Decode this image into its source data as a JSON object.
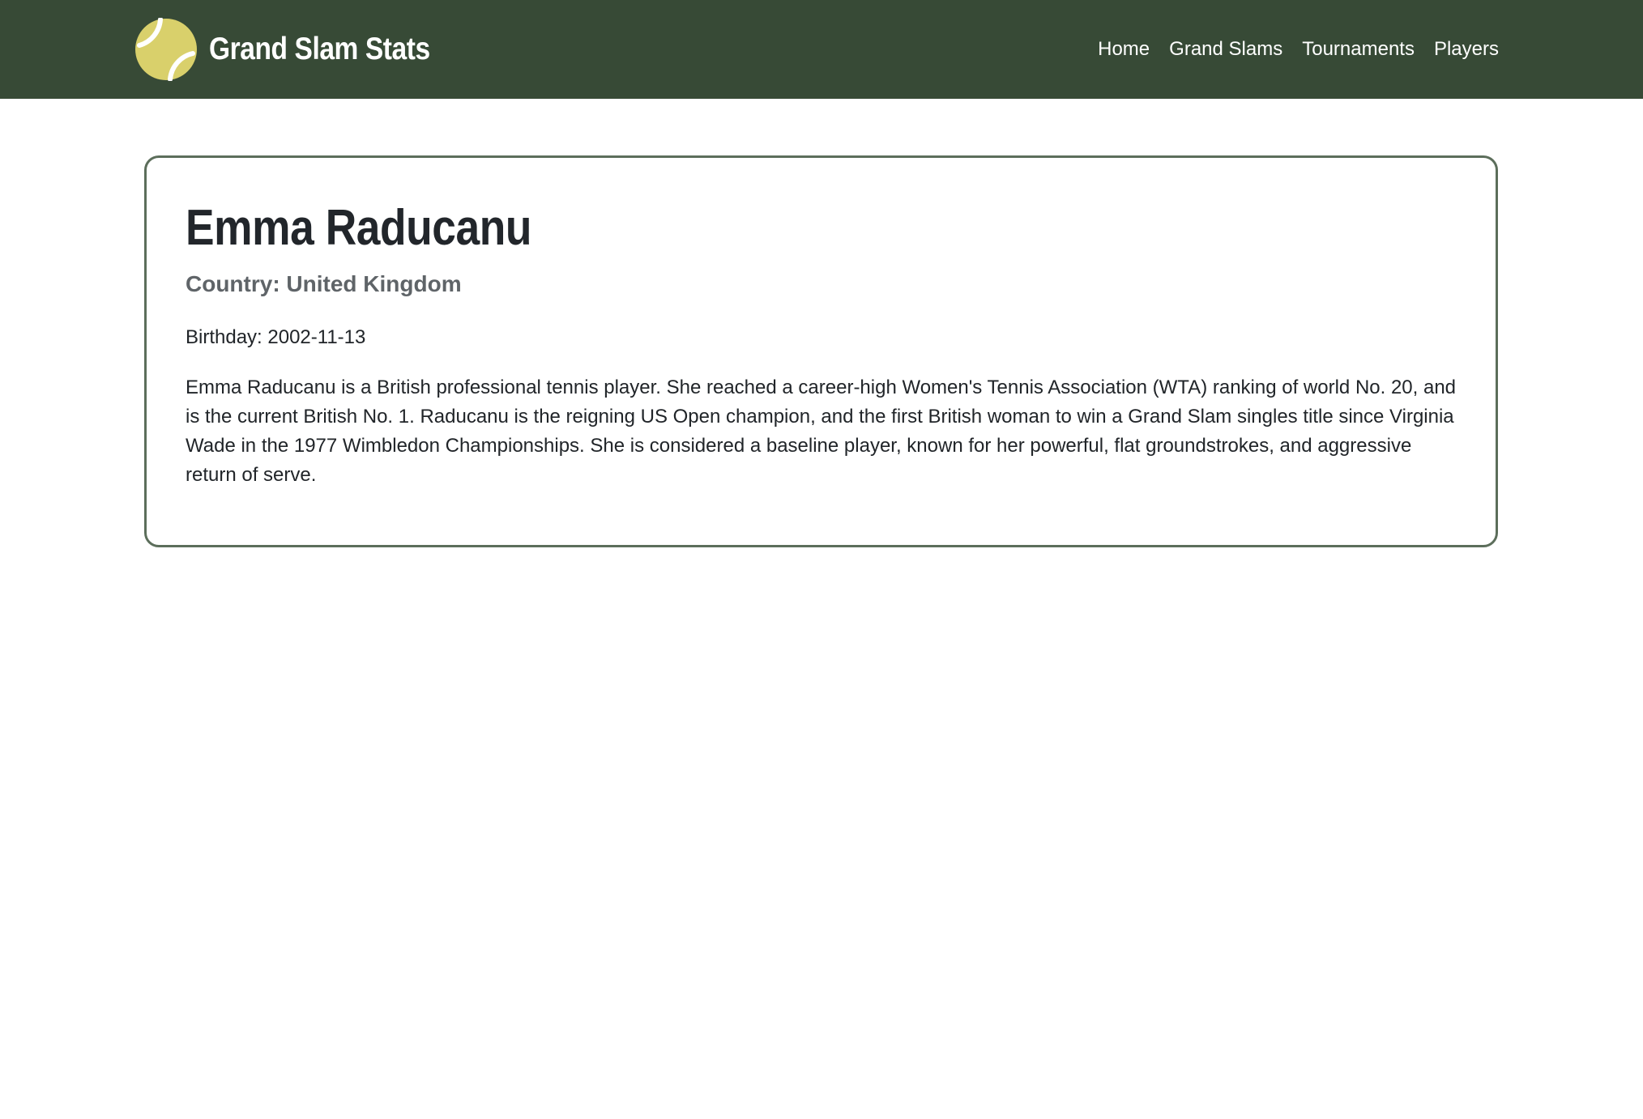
{
  "header": {
    "brand": "Grand Slam Stats",
    "logo_icon": "tennis-ball-icon",
    "nav": [
      "Home",
      "Grand Slams",
      "Tournaments",
      "Players"
    ]
  },
  "player": {
    "name": "Emma Raducanu",
    "country": "Country: United Kingdom",
    "birthday": "Birthday: 2002-11-13",
    "bio": "Emma Raducanu is a British professional tennis player. She reached a career-high Women's Tennis Association (WTA) ranking of world No. 20, and is the current British No. 1. Raducanu is the reigning US Open champion, and the first British woman to win a Grand Slam singles title since Virginia Wade in the 1977 Wimbledon Championships. She is considered a baseline player, known for her powerful, flat groundstrokes, and aggressive return of serve."
  },
  "colors": {
    "navbar_bg": "#374a36",
    "card_border": "#5c6e5b",
    "ball": "#d9d06b"
  }
}
